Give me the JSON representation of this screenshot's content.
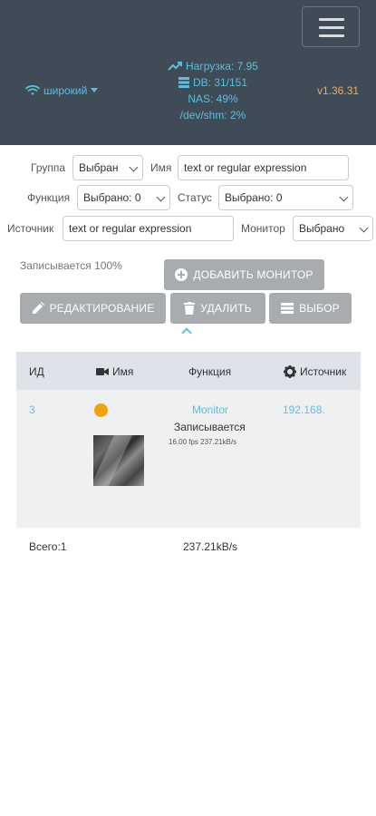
{
  "header": {
    "bandwidth": "широкий",
    "stats": {
      "load": "Нагрузка: 7.95",
      "db": "DB: 31/151",
      "nas": "NAS: 49%",
      "shm": "/dev/shm: 2%"
    },
    "version": "v1.36.31"
  },
  "filters": {
    "group_label": "Группа",
    "group_value": "Выбран",
    "name_label": "Имя",
    "name_placeholder": "text or regular expression",
    "function_label": "Функция",
    "function_value": "Выбрано: 0",
    "status_label": "Статус",
    "status_value": "Выбрано: 0",
    "source_label": "Источник",
    "source_placeholder": "text or regular expression",
    "monitor_label": "Монитор",
    "monitor_value": "Выбрано"
  },
  "recording_status": "Записывается 100%",
  "buttons": {
    "add_monitor": "ДОБАВИТЬ МОНИТОР",
    "edit": "РЕДАКТИРОВАНИЕ",
    "delete": "УДАЛИТЬ",
    "select": "ВЫБОР"
  },
  "table": {
    "headers": {
      "id": "ИД",
      "name": "Имя",
      "function": "Функция",
      "source": "Источник"
    },
    "rows": [
      {
        "id": "3",
        "function": "Monitor",
        "status": "Записывается",
        "fps": "16.00 fps 237.21kB/s",
        "source": "192.168."
      }
    ]
  },
  "footer": {
    "total": "Всего:1",
    "bandwidth": "237.21kB/s"
  },
  "colors": {
    "header_bg": "#3f4b56",
    "accent": "#5bc0de",
    "version": "#f0ad4e",
    "status_dot": "#f0a30a",
    "button_bg": "#a9acae"
  }
}
